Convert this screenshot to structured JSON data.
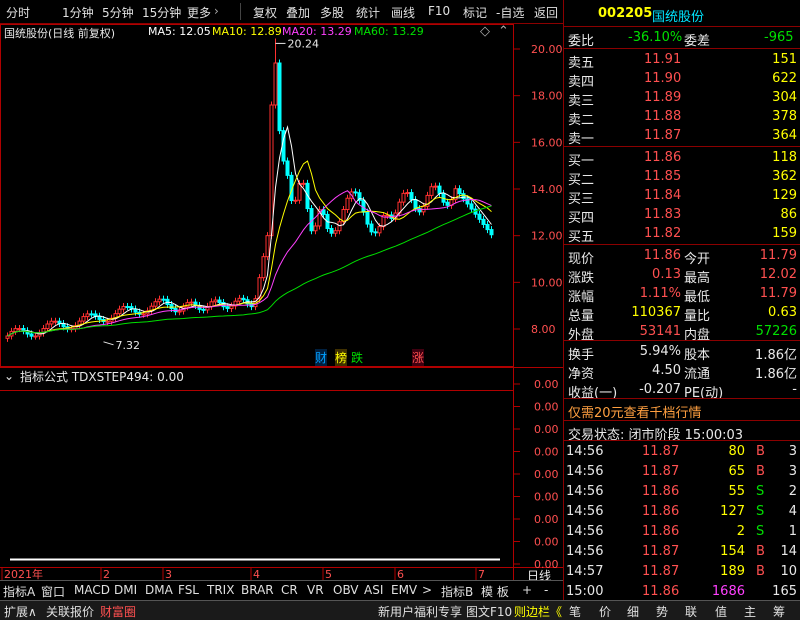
{
  "toolbar": {
    "items": [
      "分时",
      "1分钟",
      "5分钟",
      "15分钟",
      "更多",
      "复权",
      "叠加",
      "多股",
      "统计",
      "画线",
      "F10",
      "标记",
      "-自选",
      "返回"
    ],
    "more_arrow": "›"
  },
  "chart": {
    "stock_label": "国统股份(日线 前复权)",
    "ma": [
      {
        "label": "MA5: 12.05",
        "color": "#ffffff"
      },
      {
        "label": "MA10: 12.89",
        "color": "#ffff00"
      },
      {
        "label": "MA20: 13.29",
        "color": "#ff40ff"
      },
      {
        "label": "MA60: 13.29",
        "color": "#00e000"
      }
    ],
    "high_label": "20.24",
    "low_label": "7.32",
    "price_ticks": [
      "20.00",
      "18.00",
      "16.00",
      "14.00",
      "12.00",
      "10.00",
      "8.00"
    ],
    "events": [
      {
        "text": "财",
        "color": "#00a0ff"
      },
      {
        "text": "榜",
        "color": "#ffff00"
      },
      {
        "text": "跌",
        "color": "#00e000"
      },
      {
        "text": "涨",
        "color": "#ff5050"
      }
    ],
    "indicator_label": "指标公式  TDXSTEP494: 0.00",
    "indicator_ticks": [
      "0.00",
      "0.00",
      "0.00",
      "0.00",
      "0.00",
      "0.00",
      "0.00",
      "0.00",
      "0.00"
    ],
    "x_labels": [
      "2021年",
      "2",
      "3",
      "4",
      "5",
      "6",
      "7"
    ],
    "period": "日线",
    "colors": {
      "up": "#ff3030",
      "down": "#00ffff",
      "frame": "#b00000"
    }
  },
  "tabs": [
    "指标A",
    "窗口",
    "MACD",
    "DMI",
    "DMA",
    "FSL",
    "TRIX",
    "BRAR",
    "CR",
    "VR",
    "OBV",
    "ASI",
    "EMV",
    ">",
    "指标B",
    "模 板",
    "+",
    "-"
  ],
  "status": {
    "left": [
      "扩展∧",
      "关联报价",
      "财富圈"
    ],
    "right": [
      "新用户福利专享",
      "图文F10",
      "则边栏《"
    ],
    "icons": [
      "笔",
      "价",
      "细",
      "势",
      "联",
      "值",
      "主",
      "筹"
    ]
  },
  "quote": {
    "code": "002205",
    "name": "国统股份",
    "webi_label": "委比",
    "webi_value": "-36.10%",
    "weicha_label": "委差",
    "weicha_value": "-965",
    "sells": [
      {
        "label": "卖五",
        "price": "11.91",
        "vol": "151"
      },
      {
        "label": "卖四",
        "price": "11.90",
        "vol": "622"
      },
      {
        "label": "卖三",
        "price": "11.89",
        "vol": "304"
      },
      {
        "label": "卖二",
        "price": "11.88",
        "vol": "378"
      },
      {
        "label": "卖一",
        "price": "11.87",
        "vol": "364"
      }
    ],
    "buys": [
      {
        "label": "买一",
        "price": "11.86",
        "vol": "118"
      },
      {
        "label": "买二",
        "price": "11.85",
        "vol": "362"
      },
      {
        "label": "买三",
        "price": "11.84",
        "vol": "129"
      },
      {
        "label": "买四",
        "price": "11.83",
        "vol": "86"
      },
      {
        "label": "买五",
        "price": "11.82",
        "vol": "159"
      }
    ],
    "stats": [
      {
        "l1": "现价",
        "v1": "11.86",
        "l2": "今开",
        "v2": "11.79"
      },
      {
        "l1": "涨跌",
        "v1": "0.13",
        "l2": "最高",
        "v2": "12.02"
      },
      {
        "l1": "涨幅",
        "v1": "1.11%",
        "l2": "最低",
        "v2": "11.79"
      },
      {
        "l1": "总量",
        "v1": "110367",
        "l2": "量比",
        "v2": "0.63"
      },
      {
        "l1": "外盘",
        "v1": "53141",
        "l2": "内盘",
        "v2": "57226"
      }
    ],
    "stats2": [
      {
        "l1": "换手",
        "v1": "5.94%",
        "l2": "股本",
        "v2": "1.86亿"
      },
      {
        "l1": "净资",
        "v1": "4.50",
        "l2": "流通",
        "v2": "1.86亿"
      },
      {
        "l1": "收益(一)",
        "v1": "-0.207",
        "l2": "PE(动)",
        "v2": "-"
      }
    ],
    "promo": "仅需20元查看千档行情",
    "trade_state": "交易状态: 闭市阶段 15:00:03",
    "ticks": [
      {
        "t": "14:56",
        "p": "11.87",
        "v": "80",
        "s": "B",
        "n": "3"
      },
      {
        "t": "14:56",
        "p": "11.87",
        "v": "65",
        "s": "B",
        "n": "3"
      },
      {
        "t": "14:56",
        "p": "11.86",
        "v": "55",
        "s": "S",
        "n": "2"
      },
      {
        "t": "14:56",
        "p": "11.86",
        "v": "127",
        "s": "S",
        "n": "4"
      },
      {
        "t": "14:56",
        "p": "11.86",
        "v": "2",
        "s": "S",
        "n": "1"
      },
      {
        "t": "14:56",
        "p": "11.87",
        "v": "154",
        "s": "B",
        "n": "14"
      },
      {
        "t": "14:57",
        "p": "11.87",
        "v": "189",
        "s": "B",
        "n": "10"
      },
      {
        "t": "15:00",
        "p": "11.86",
        "v": "1686",
        "s": "",
        "n": "165"
      }
    ]
  }
}
